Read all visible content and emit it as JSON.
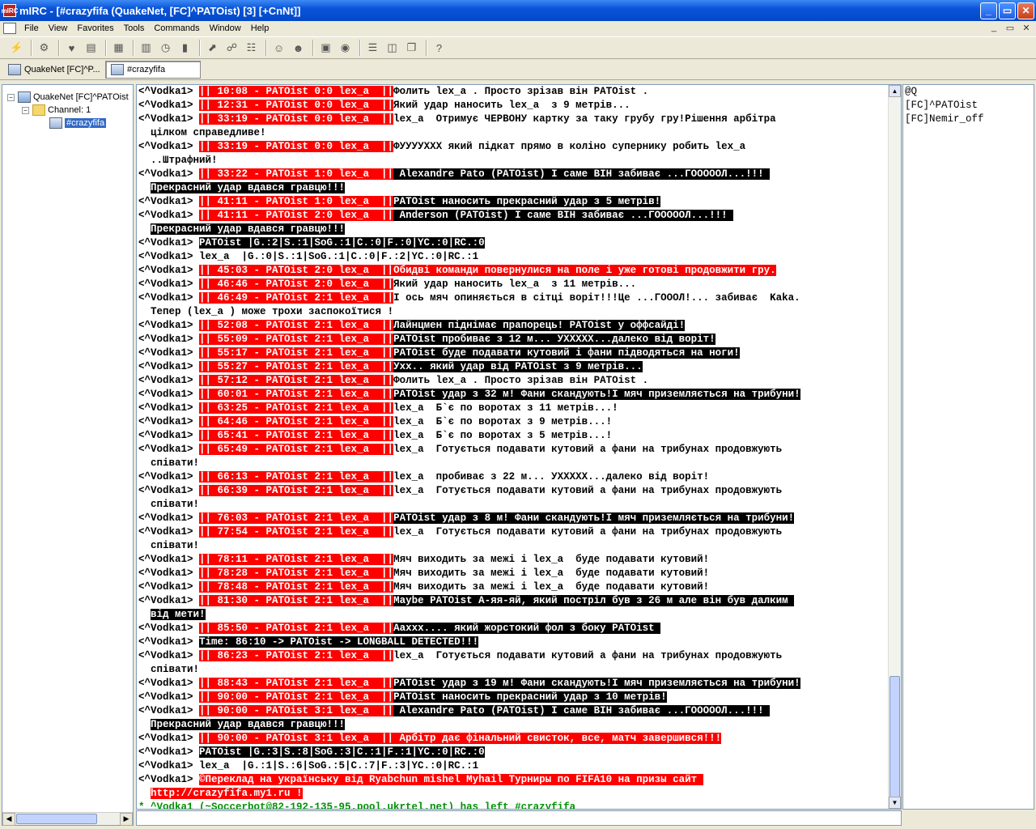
{
  "window": {
    "title": "mIRC - [#crazyfifa (QuakeNet, [FC]^PATOist) [3] [+CnNt]]",
    "app_icon": "mIRC",
    "minimize": "_",
    "maximize": "▭",
    "close": "✕"
  },
  "menu": [
    "File",
    "View",
    "Favorites",
    "Tools",
    "Commands",
    "Window",
    "Help"
  ],
  "mdi_controls": {
    "minimize": "_",
    "restore": "▭",
    "close": "✕"
  },
  "toolbar_icons": [
    "connect-icon",
    "options-icon",
    "favorites-icon",
    "address-book-icon",
    "log-icon",
    "received-icon",
    "timer-icon",
    "colors-icon",
    "dcc-send-icon",
    "dcc-chat-icon",
    "channel-list-icon",
    "notify-icon",
    "urls-icon",
    "scripts-icon",
    "aliases-icon",
    "tile-h-icon",
    "tile-v-icon",
    "cascade-icon",
    "help-icon"
  ],
  "switchbar": {
    "server_tab": "QuakeNet [FC]^P...",
    "channel_tab": "#crazyfifa"
  },
  "tree": {
    "server": "QuakeNet [FC]^PATOist",
    "channel_folder": "Channel: 1",
    "channel": "#crazyfifa"
  },
  "nicklist": [
    "@Q",
    "[FC]^PATOist",
    "[FC]Nemir_off"
  ],
  "chat": [
    {
      "nick": "<^Vodka1> ",
      "seg": [
        [
          "red",
          "|| 10:08 - PATOist 0:0 lex_a  ||"
        ],
        [
          "",
          "Фолить lex_a . Просто зрізав він PATOist ."
        ]
      ]
    },
    {
      "nick": "<^Vodka1> ",
      "seg": [
        [
          "red",
          "|| 12:31 - PATOist 0:0 lex_a  ||"
        ],
        [
          "",
          "Який удар наносить lex_a  з 9 метрів..."
        ]
      ]
    },
    {
      "nick": "<^Vodka1> ",
      "seg": [
        [
          "red",
          "|| 33:19 - PATOist 0:0 lex_a  ||"
        ],
        [
          "",
          "lex_a  Отримує ЧЕРВОНУ картку за таку грубу гру!Рішення арбітра"
        ]
      ]
    },
    {
      "nick": "  ",
      "seg": [
        [
          "",
          "цілком справедливе!"
        ]
      ]
    },
    {
      "nick": "<^Vodka1> ",
      "seg": [
        [
          "red",
          "|| 33:19 - PATOist 0:0 lex_a  ||"
        ],
        [
          "",
          "ФУУУУХХХ який підкат прямо в коліно супернику робить lex_a"
        ]
      ]
    },
    {
      "nick": "  ",
      "seg": [
        [
          "",
          "..Штрафний!"
        ]
      ]
    },
    {
      "nick": "<^Vodka1> ",
      "seg": [
        [
          "red",
          "|| 33:22 - PATOist 1:0 lex_a  ||"
        ],
        [
          "blk",
          " Alexandre Pato (PATOist) І саме ВІН забиває ...ГОООООЛ...!!! "
        ]
      ]
    },
    {
      "nick": "  ",
      "seg": [
        [
          "blk",
          "Прекрасний удар вдався гравцю!!!"
        ]
      ]
    },
    {
      "nick": "<^Vodka1> ",
      "seg": [
        [
          "red",
          "|| 41:11 - PATOist 1:0 lex_a  ||"
        ],
        [
          "blk",
          "PATOist наносить прекрасний удар з 5 метрів!"
        ]
      ]
    },
    {
      "nick": "<^Vodka1> ",
      "seg": [
        [
          "red",
          "|| 41:11 - PATOist 2:0 lex_a  ||"
        ],
        [
          "blk",
          " Anderson (PATOist) І саме ВІН забиває ...ГОООООЛ...!!! "
        ]
      ]
    },
    {
      "nick": "  ",
      "seg": [
        [
          "blk",
          "Прекрасний удар вдався гравцю!!!"
        ]
      ]
    },
    {
      "nick": "<^Vodka1> ",
      "seg": [
        [
          "blk",
          "PATOist |G.:2|S.:1|SoG.:1|C.:0|F.:0|YC.:0|RC.:0"
        ]
      ]
    },
    {
      "nick": "<^Vodka1> ",
      "seg": [
        [
          "",
          "lex_a  |G.:0|S.:1|SoG.:1|C.:0|F.:2|YC.:0|RC.:1"
        ]
      ]
    },
    {
      "nick": "<^Vodka1> ",
      "seg": [
        [
          "red",
          "|| 45:03 - PATOist 2:0 lex_a  ||"
        ],
        [
          "red",
          "Обидві команди повернулися на поле і уже готові продовжити гру."
        ]
      ]
    },
    {
      "nick": "<^Vodka1> ",
      "seg": [
        [
          "red",
          "|| 46:46 - PATOist 2:0 lex_a  ||"
        ],
        [
          "",
          "Який удар наносить lex_a  з 11 метрів..."
        ]
      ]
    },
    {
      "nick": "<^Vodka1> ",
      "seg": [
        [
          "red",
          "|| 46:49 - PATOist 2:1 lex_a  ||"
        ],
        [
          "",
          "І ось мяч опиняється в сітці воріт!!!Це ...ГОООЛ!... забиває  Kaka."
        ]
      ]
    },
    {
      "nick": "  ",
      "seg": [
        [
          "",
          "Тепер (lex_a ) може трохи заспокоїтися !"
        ]
      ]
    },
    {
      "nick": "<^Vodka1> ",
      "seg": [
        [
          "red",
          "|| 52:08 - PATOist 2:1 lex_a  ||"
        ],
        [
          "blk",
          "Лайнцмен піднімає прапорець! PATOist у оффсайді!"
        ]
      ]
    },
    {
      "nick": "<^Vodka1> ",
      "seg": [
        [
          "red",
          "|| 55:09 - PATOist 2:1 lex_a  ||"
        ],
        [
          "blk",
          "PATOist пробиває з 12 м... УХХХХХ...далеко від воріт!"
        ]
      ]
    },
    {
      "nick": "<^Vodka1> ",
      "seg": [
        [
          "red",
          "|| 55:17 - PATOist 2:1 lex_a  ||"
        ],
        [
          "blk",
          "PATOist буде подавати кутовий і фани підводяться на ноги!"
        ]
      ]
    },
    {
      "nick": "<^Vodka1> ",
      "seg": [
        [
          "red",
          "|| 55:27 - PATOist 2:1 lex_a  ||"
        ],
        [
          "blk",
          "Ухх.. який удар від PATOist з 9 метрів..."
        ]
      ]
    },
    {
      "nick": "<^Vodka1> ",
      "seg": [
        [
          "red",
          "|| 57:12 - PATOist 2:1 lex_a  ||"
        ],
        [
          "",
          "Фолить lex_a . Просто зрізав він PATOist ."
        ]
      ]
    },
    {
      "nick": "<^Vodka1> ",
      "seg": [
        [
          "red",
          "|| 60:01 - PATOist 2:1 lex_a  ||"
        ],
        [
          "blk",
          "PATOist удар з 32 м! Фани скандують!І мяч приземляється на трибуни!"
        ]
      ]
    },
    {
      "nick": "<^Vodka1> ",
      "seg": [
        [
          "red",
          "|| 63:25 - PATOist 2:1 lex_a  ||"
        ],
        [
          "",
          "lex_a  Б`є по воротах з 11 метрів...!"
        ]
      ]
    },
    {
      "nick": "<^Vodka1> ",
      "seg": [
        [
          "red",
          "|| 64:46 - PATOist 2:1 lex_a  ||"
        ],
        [
          "",
          "lex_a  Б`є по воротах з 9 метрів...!"
        ]
      ]
    },
    {
      "nick": "<^Vodka1> ",
      "seg": [
        [
          "red",
          "|| 65:41 - PATOist 2:1 lex_a  ||"
        ],
        [
          "",
          "lex_a  Б`є по воротах з 5 метрів...!"
        ]
      ]
    },
    {
      "nick": "<^Vodka1> ",
      "seg": [
        [
          "red",
          "|| 65:49 - PATOist 2:1 lex_a  ||"
        ],
        [
          "",
          "lex_a  Готується подавати кутовий а фани на трибунах продовжують"
        ]
      ]
    },
    {
      "nick": "  ",
      "seg": [
        [
          "",
          "співати!"
        ]
      ]
    },
    {
      "nick": "<^Vodka1> ",
      "seg": [
        [
          "red",
          "|| 66:13 - PATOist 2:1 lex_a  ||"
        ],
        [
          "",
          "lex_a  пробиває з 22 м... УХХХХХ...далеко від воріт!"
        ]
      ]
    },
    {
      "nick": "<^Vodka1> ",
      "seg": [
        [
          "red",
          "|| 66:39 - PATOist 2:1 lex_a  ||"
        ],
        [
          "",
          "lex_a  Готується подавати кутовий а фани на трибунах продовжують"
        ]
      ]
    },
    {
      "nick": "  ",
      "seg": [
        [
          "",
          "співати!"
        ]
      ]
    },
    {
      "nick": "<^Vodka1> ",
      "seg": [
        [
          "red",
          "|| 76:03 - PATOist 2:1 lex_a  ||"
        ],
        [
          "blk",
          "PATOist удар з 8 м! Фани скандують!І мяч приземляється на трибуни!"
        ]
      ]
    },
    {
      "nick": "<^Vodka1> ",
      "seg": [
        [
          "red",
          "|| 77:54 - PATOist 2:1 lex_a  ||"
        ],
        [
          "",
          "lex_a  Готується подавати кутовий а фани на трибунах продовжують"
        ]
      ]
    },
    {
      "nick": "  ",
      "seg": [
        [
          "",
          "співати!"
        ]
      ]
    },
    {
      "nick": "<^Vodka1> ",
      "seg": [
        [
          "red",
          "|| 78:11 - PATOist 2:1 lex_a  ||"
        ],
        [
          "",
          "Мяч виходить за межі і lex_a  буде подавати кутовий!"
        ]
      ]
    },
    {
      "nick": "<^Vodka1> ",
      "seg": [
        [
          "red",
          "|| 78:28 - PATOist 2:1 lex_a  ||"
        ],
        [
          "",
          "Мяч виходить за межі і lex_a  буде подавати кутовий!"
        ]
      ]
    },
    {
      "nick": "<^Vodka1> ",
      "seg": [
        [
          "red",
          "|| 78:48 - PATOist 2:1 lex_a  ||"
        ],
        [
          "",
          "Мяч виходить за межі і lex_a  буде подавати кутовий!"
        ]
      ]
    },
    {
      "nick": "<^Vodka1> ",
      "seg": [
        [
          "red",
          "|| 81:30 - PATOist 2:1 lex_a  ||"
        ],
        [
          "blk",
          "Maybe PATOist А-яя-яй, який постріл був з 26 м але він був далким "
        ]
      ]
    },
    {
      "nick": "  ",
      "seg": [
        [
          "blk",
          "від мети!"
        ]
      ]
    },
    {
      "nick": "<^Vodka1> ",
      "seg": [
        [
          "red",
          "|| 85:50 - PATOist 2:1 lex_a  ||"
        ],
        [
          "blk",
          "Aaxxx.... який жорстокий фол з боку PATOist "
        ]
      ]
    },
    {
      "nick": "<^Vodka1> ",
      "seg": [
        [
          "blk",
          "Time: 86:10 -> PATOist -> LONGBALL DETECTED!!!"
        ]
      ]
    },
    {
      "nick": "<^Vodka1> ",
      "seg": [
        [
          "red",
          "|| 86:23 - PATOist 2:1 lex_a  ||"
        ],
        [
          "",
          "lex_a  Готується подавати кутовий а фани на трибунах продовжують"
        ]
      ]
    },
    {
      "nick": "  ",
      "seg": [
        [
          "",
          "співати!"
        ]
      ]
    },
    {
      "nick": "<^Vodka1> ",
      "seg": [
        [
          "red",
          "|| 88:43 - PATOist 2:1 lex_a  ||"
        ],
        [
          "blk",
          "PATOist удар з 19 м! Фани скандують!І мяч приземляється на трибуни!"
        ]
      ]
    },
    {
      "nick": "<^Vodka1> ",
      "seg": [
        [
          "red",
          "|| 90:00 - PATOist 2:1 lex_a  ||"
        ],
        [
          "blk",
          "PATOist наносить прекрасний удар з 10 метрів!"
        ]
      ]
    },
    {
      "nick": "<^Vodka1> ",
      "seg": [
        [
          "red",
          "|| 90:00 - PATOist 3:1 lex_a  ||"
        ],
        [
          "blk",
          " Alexandre Pato (PATOist) І саме ВІН забиває ...ГОООООЛ...!!! "
        ]
      ]
    },
    {
      "nick": "  ",
      "seg": [
        [
          "blk",
          "Прекрасний удар вдався гравцю!!!"
        ]
      ]
    },
    {
      "nick": "<^Vodka1> ",
      "seg": [
        [
          "red",
          "|| 90:00 - PATOist 3:1 lex_a  || Арбітр дає фінальний свисток, все, матч завершився!!!"
        ]
      ]
    },
    {
      "nick": "<^Vodka1> ",
      "seg": [
        [
          "blk",
          "PATOist |G.:3|S.:8|SoG.:3|C.:1|F.:1|YC.:0|RC.:0"
        ]
      ]
    },
    {
      "nick": "<^Vodka1> ",
      "seg": [
        [
          "",
          "lex_a  |G.:1|S.:6|SoG.:5|C.:7|F.:3|YC.:0|RC.:1"
        ]
      ]
    },
    {
      "nick": "<^Vodka1> ",
      "seg": [
        [
          "red",
          "©Переклад на українську від Ryabchun mishel Myhail Турниры по FIFA10 на призы сайт "
        ]
      ]
    },
    {
      "nick": "  ",
      "seg": [
        [
          "red",
          "http://crazyfifa.my1.ru !"
        ]
      ]
    },
    {
      "nick": "",
      "seg": [
        [
          "grn",
          "* ^Vodka1 (~Soccerbot@82-192-135-95.pool.ukrtel.net) has left #crazyfifa"
        ]
      ]
    }
  ]
}
